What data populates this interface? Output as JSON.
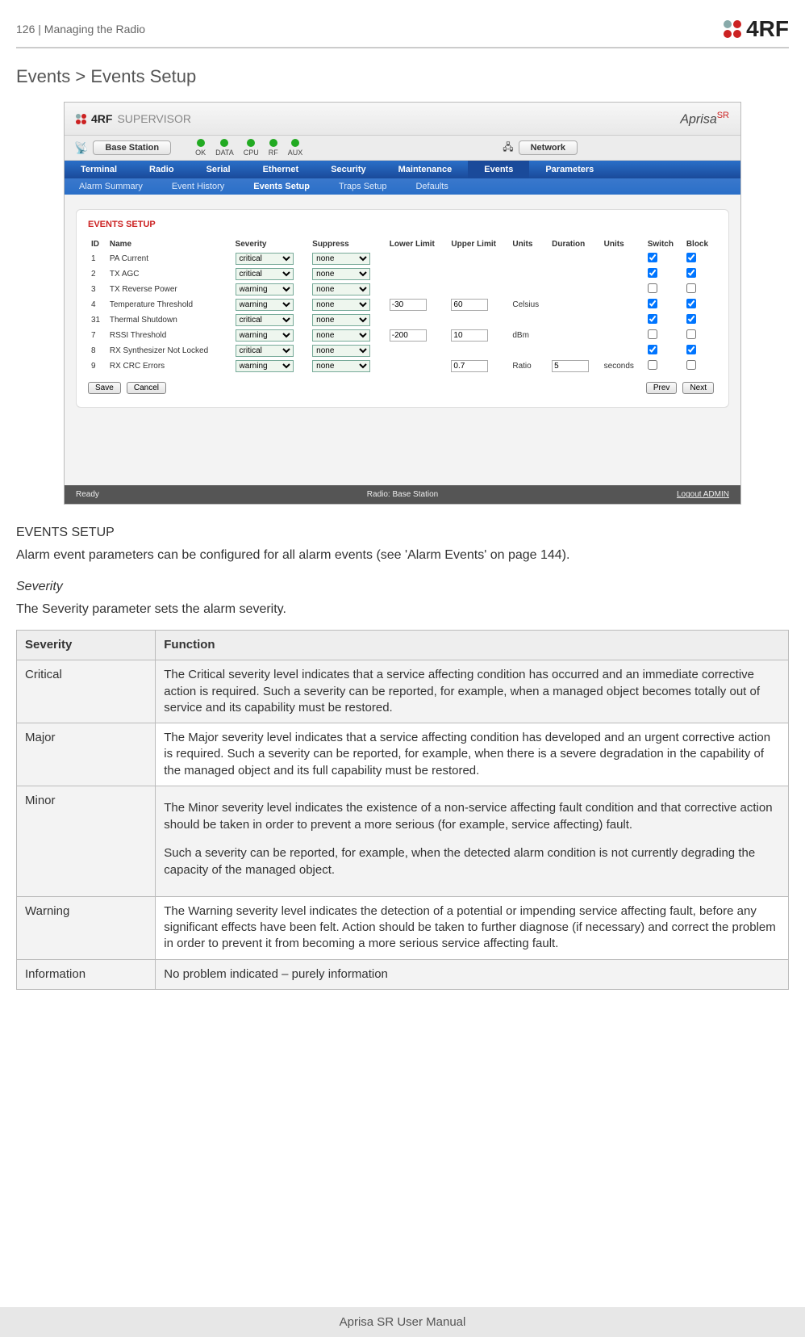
{
  "page": {
    "number": "126",
    "section": "Managing the Radio",
    "brand": "4RF",
    "footer": "Aprisa SR User Manual"
  },
  "title": "Events > Events Setup",
  "screenshot": {
    "brand_text": "SUPERVISOR",
    "aprisa_text": "Aprisa",
    "aprisa_suffix": "SR",
    "base_station_btn": "Base Station",
    "network_btn": "Network",
    "leds": [
      "OK",
      "DATA",
      "CPU",
      "RF",
      "AUX"
    ],
    "nav": [
      "Terminal",
      "Radio",
      "Serial",
      "Ethernet",
      "Security",
      "Maintenance",
      "Events",
      "Parameters"
    ],
    "nav_active": "Events",
    "subnav": [
      "Alarm Summary",
      "Event History",
      "Events Setup",
      "Traps Setup",
      "Defaults"
    ],
    "subnav_active": "Events Setup",
    "panel_title": "EVENTS SETUP",
    "columns": [
      "ID",
      "Name",
      "Severity",
      "Suppress",
      "Lower Limit",
      "Upper Limit",
      "Units",
      "Duration",
      "Units",
      "Switch",
      "Block"
    ],
    "rows": [
      {
        "id": "1",
        "name": "PA Current",
        "severity": "critical",
        "suppress": "none",
        "low": "",
        "up": "",
        "units": "",
        "dur": "",
        "units2": "",
        "switch": true,
        "block": true
      },
      {
        "id": "2",
        "name": "TX AGC",
        "severity": "critical",
        "suppress": "none",
        "low": "",
        "up": "",
        "units": "",
        "dur": "",
        "units2": "",
        "switch": true,
        "block": true
      },
      {
        "id": "3",
        "name": "TX Reverse Power",
        "severity": "warning",
        "suppress": "none",
        "low": "",
        "up": "",
        "units": "",
        "dur": "",
        "units2": "",
        "switch": false,
        "block": false
      },
      {
        "id": "4",
        "name": "Temperature Threshold",
        "severity": "warning",
        "suppress": "none",
        "low": "-30",
        "up": "60",
        "units": "Celsius",
        "dur": "",
        "units2": "",
        "switch": true,
        "block": true
      },
      {
        "id": "31",
        "name": "Thermal Shutdown",
        "severity": "critical",
        "suppress": "none",
        "low": "",
        "up": "",
        "units": "",
        "dur": "",
        "units2": "",
        "switch": true,
        "block": true
      },
      {
        "id": "7",
        "name": "RSSI Threshold",
        "severity": "warning",
        "suppress": "none",
        "low": "-200",
        "up": "10",
        "units": "dBm",
        "dur": "",
        "units2": "",
        "switch": false,
        "block": false
      },
      {
        "id": "8",
        "name": "RX Synthesizer Not Locked",
        "severity": "critical",
        "suppress": "none",
        "low": "",
        "up": "",
        "units": "",
        "dur": "",
        "units2": "",
        "switch": true,
        "block": true
      },
      {
        "id": "9",
        "name": "RX CRC Errors",
        "severity": "warning",
        "suppress": "none",
        "low": "",
        "up": "0.7",
        "units": "Ratio",
        "dur": "5",
        "units2": "seconds",
        "switch": false,
        "block": false
      }
    ],
    "buttons": {
      "save": "Save",
      "cancel": "Cancel",
      "prev": "Prev",
      "next": "Next"
    },
    "status": {
      "left": "Ready",
      "center": "Radio: Base Station",
      "right": "Logout ADMIN"
    }
  },
  "events_setup_heading": "EVENTS SETUP",
  "events_setup_text": "Alarm event parameters can be configured for all alarm events (see 'Alarm Events' on page 144).",
  "severity_heading": "Severity",
  "severity_text": "The Severity parameter sets the alarm severity.",
  "table": {
    "headers": {
      "severity": "Severity",
      "function": "Function"
    },
    "rows": [
      {
        "severity": "Critical",
        "function": "The Critical severity level indicates that a service affecting condition has occurred and an immediate corrective action is required. Such a severity can be reported, for example, when a managed object becomes totally out of service and its capability must be restored."
      },
      {
        "severity": "Major",
        "function": "The Major severity level indicates that a service affecting condition has developed and an urgent corrective action is required. Such a severity can be reported, for example, when there is a severe degradation in the capability of the managed object and its full capability must be restored."
      },
      {
        "severity": "Minor",
        "function": "The Minor severity level indicates the existence of a non-service affecting fault condition and that corrective action should be taken in order to prevent a more serious (for example, service affecting) fault.",
        "function2": "Such a severity can be reported, for example, when the detected alarm condition is not currently degrading the capacity of the managed object."
      },
      {
        "severity": "Warning",
        "function": "The Warning severity level indicates the detection of a potential or impending service affecting fault, before any significant effects have been felt. Action should be taken to further diagnose (if necessary) and correct the problem in order to prevent it from becoming a more serious service affecting fault."
      },
      {
        "severity": "Information",
        "function": "No problem indicated – purely information"
      }
    ]
  }
}
